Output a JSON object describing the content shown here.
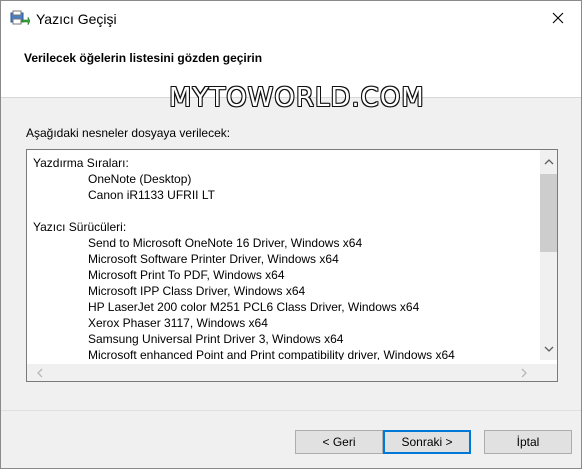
{
  "window": {
    "title": "Yazıcı Geçişi",
    "close_glyph": "✕"
  },
  "header": {
    "title": "Verilecek öğelerin listesini gözden geçirin"
  },
  "watermark": "MYTOWORLD.COM",
  "description": "Aşağıdaki nesneler dosyaya verilecek:",
  "list": {
    "sections": [
      {
        "title": "Yazdırma Sıraları:",
        "items": [
          "OneNote (Desktop)",
          "Canon iR1133 UFRII LT"
        ]
      },
      {
        "title": "Yazıcı Sürücüleri:",
        "items": [
          "Send to Microsoft OneNote 16 Driver, Windows x64",
          "Microsoft Software Printer Driver, Windows x64",
          "Microsoft Print To PDF, Windows x64",
          "Microsoft IPP Class Driver, Windows x64",
          "HP LaserJet 200 color M251 PCL6 Class Driver, Windows x64",
          "Xerox Phaser 3117, Windows x64",
          "Samsung Universal Print Driver 3, Windows x64",
          "Microsoft enhanced Point and Print compatibility driver, Windows x64"
        ]
      }
    ]
  },
  "buttons": {
    "back": "< Geri",
    "next": "Sonraki >",
    "cancel": "İptal"
  },
  "colors": {
    "accent": "#0078d7",
    "button_bg": "#e1e1e1",
    "dialog_bg": "#f0f0f0",
    "scroll_thumb": "#cdcdcd"
  },
  "icons": {
    "app": "printer-migration-icon",
    "close": "close-icon",
    "scroll_up": "chevron-up-icon",
    "scroll_down": "chevron-down-icon",
    "scroll_left": "chevron-left-icon",
    "scroll_right": "chevron-right-icon"
  }
}
